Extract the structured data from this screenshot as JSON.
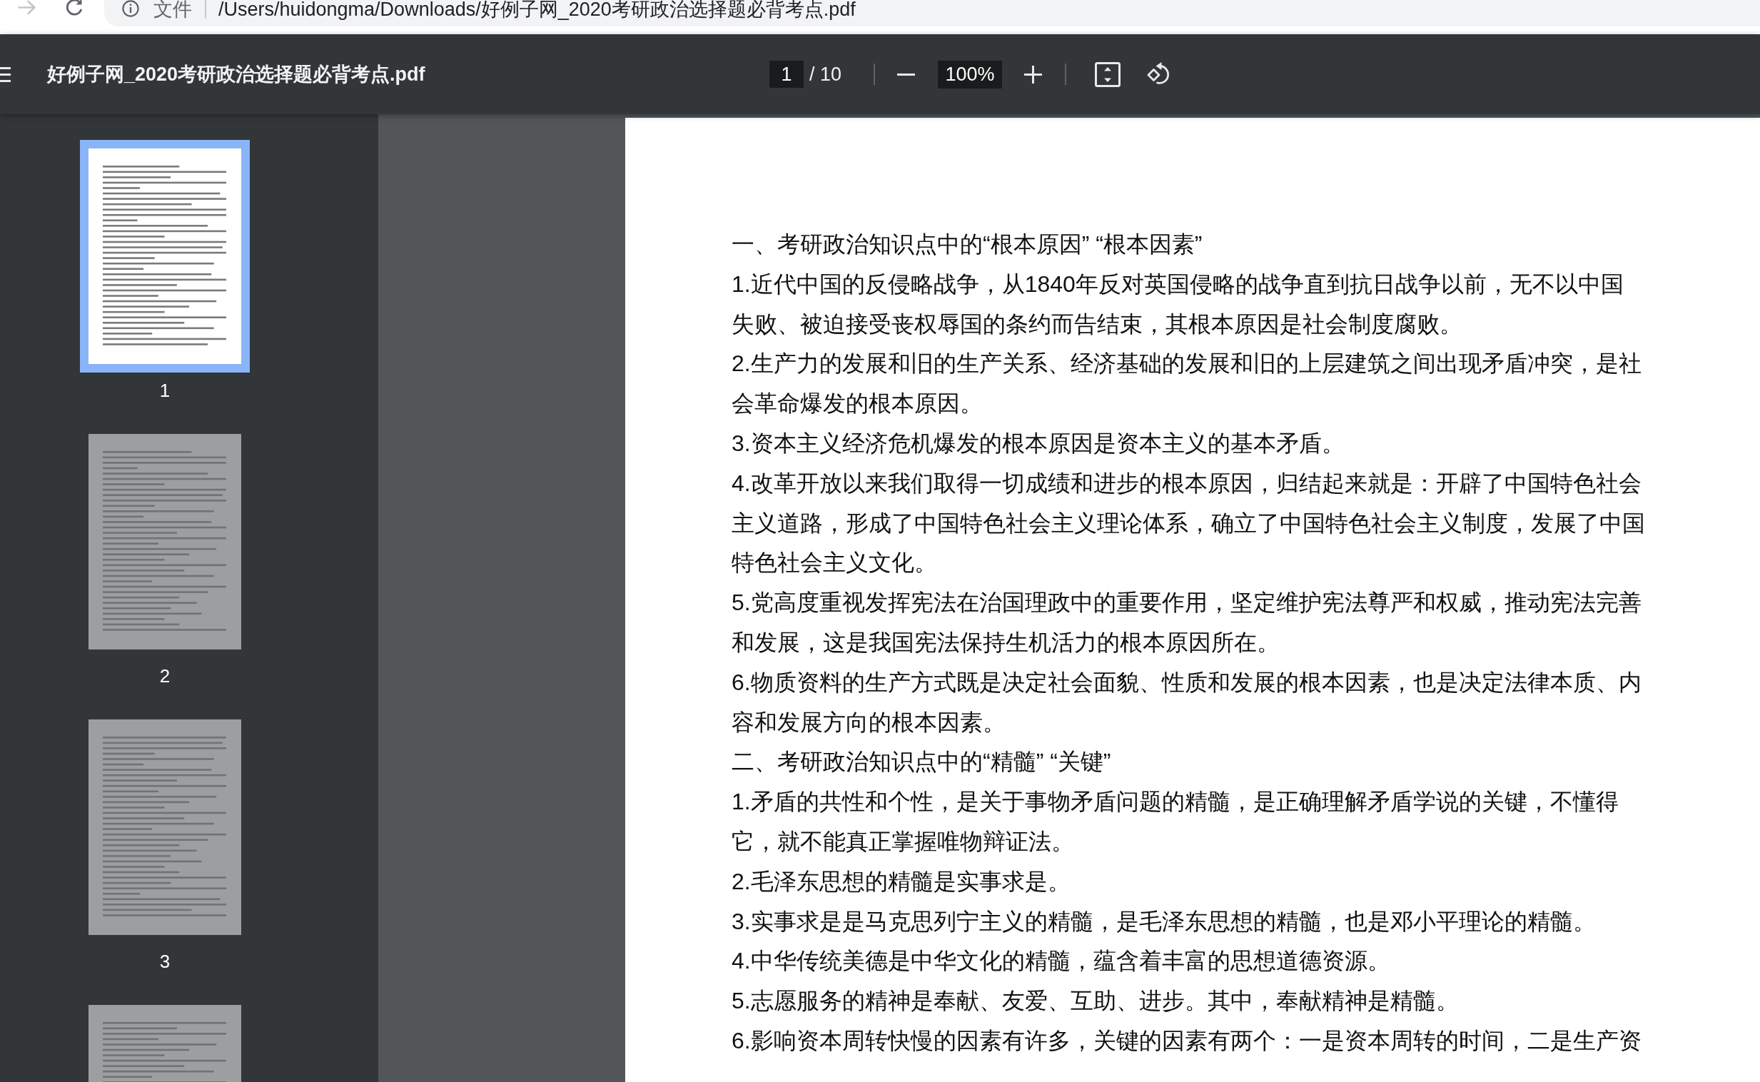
{
  "browser": {
    "forward_button": {
      "disabled": true
    },
    "address_bar": {
      "scheme": "文件",
      "url": "/Users/huidongma/Downloads/好例子网_2020考研政治选择题必背考点.pdf"
    }
  },
  "toolbar": {
    "title": "好例子网_2020考研政治选择题必背考点.pdf",
    "page_field": {
      "value": "1"
    },
    "page_count": "/ 10",
    "zoom_field": {
      "value": "100%"
    }
  },
  "thumbnails": [
    {
      "label": "1",
      "selected": true
    },
    {
      "label": "2",
      "selected": false
    },
    {
      "label": "3",
      "selected": false
    },
    {
      "selected": false
    }
  ],
  "document": {
    "paragraphs": [
      {
        "lines": [
          "一、考研政治知识点中的“根本原因” “根本因素”"
        ]
      },
      {
        "lines": [
          "1.近代中国的反侵略战争，从1840年反对英国侵略的战争直到抗日战争以前，无不以中国",
          "失败、被迫接受丧权辱国的条约而告结束，其根本原因是社会制度腐败。"
        ]
      },
      {
        "lines": [
          "2.生产力的发展和旧的生产关系、经济基础的发展和旧的上层建筑之间出现矛盾冲突，是社",
          "会革命爆发的根本原因。"
        ]
      },
      {
        "lines": [
          "3.资本主义经济危机爆发的根本原因是资本主义的基本矛盾。"
        ]
      },
      {
        "lines": [
          "4.改革开放以来我们取得一切成绩和进步的根本原因，归结起来就是：开辟了中国特色社会",
          "主义道路，形成了中国特色社会主义理论体系，确立了中国特色社会主义制度，发展了中国",
          "特色社会主义文化。"
        ]
      },
      {
        "lines": [
          "5.党高度重视发挥宪法在治国理政中的重要作用，坚定维护宪法尊严和权威，推动宪法完善",
          "和发展，这是我国宪法保持生机活力的根本原因所在。"
        ]
      },
      {
        "lines": [
          "6.物质资料的生产方式既是决定社会面貌、性质和发展的根本因素，也是决定法律本质、内",
          "容和发展方向的根本因素。"
        ]
      },
      {
        "lines": [
          "二、考研政治知识点中的“精髓” “关键”"
        ]
      },
      {
        "lines": [
          "1.矛盾的共性和个性，是关于事物矛盾问题的精髓，是正确理解矛盾学说的关键，不懂得",
          "它，就不能真正掌握唯物辩证法。"
        ]
      },
      {
        "lines": [
          "2.毛泽东思想的精髓是实事求是。"
        ]
      },
      {
        "lines": [
          "3.实事求是是马克思列宁主义的精髓，是毛泽东思想的精髓，也是邓小平理论的精髓。"
        ]
      },
      {
        "lines": [
          "4.中华传统美德是中华文化的精髓，蕴含着丰富的思想道德资源。"
        ]
      },
      {
        "lines": [
          "5.志愿服务的精神是奉献、友爱、互助、进步。其中，奉献精神是精髓。"
        ]
      },
      {
        "lines": [
          "6.影响资本周转快慢的因素有许多，关键的因素有两个：一是资本周转的时间，二是生产资"
        ]
      }
    ]
  }
}
